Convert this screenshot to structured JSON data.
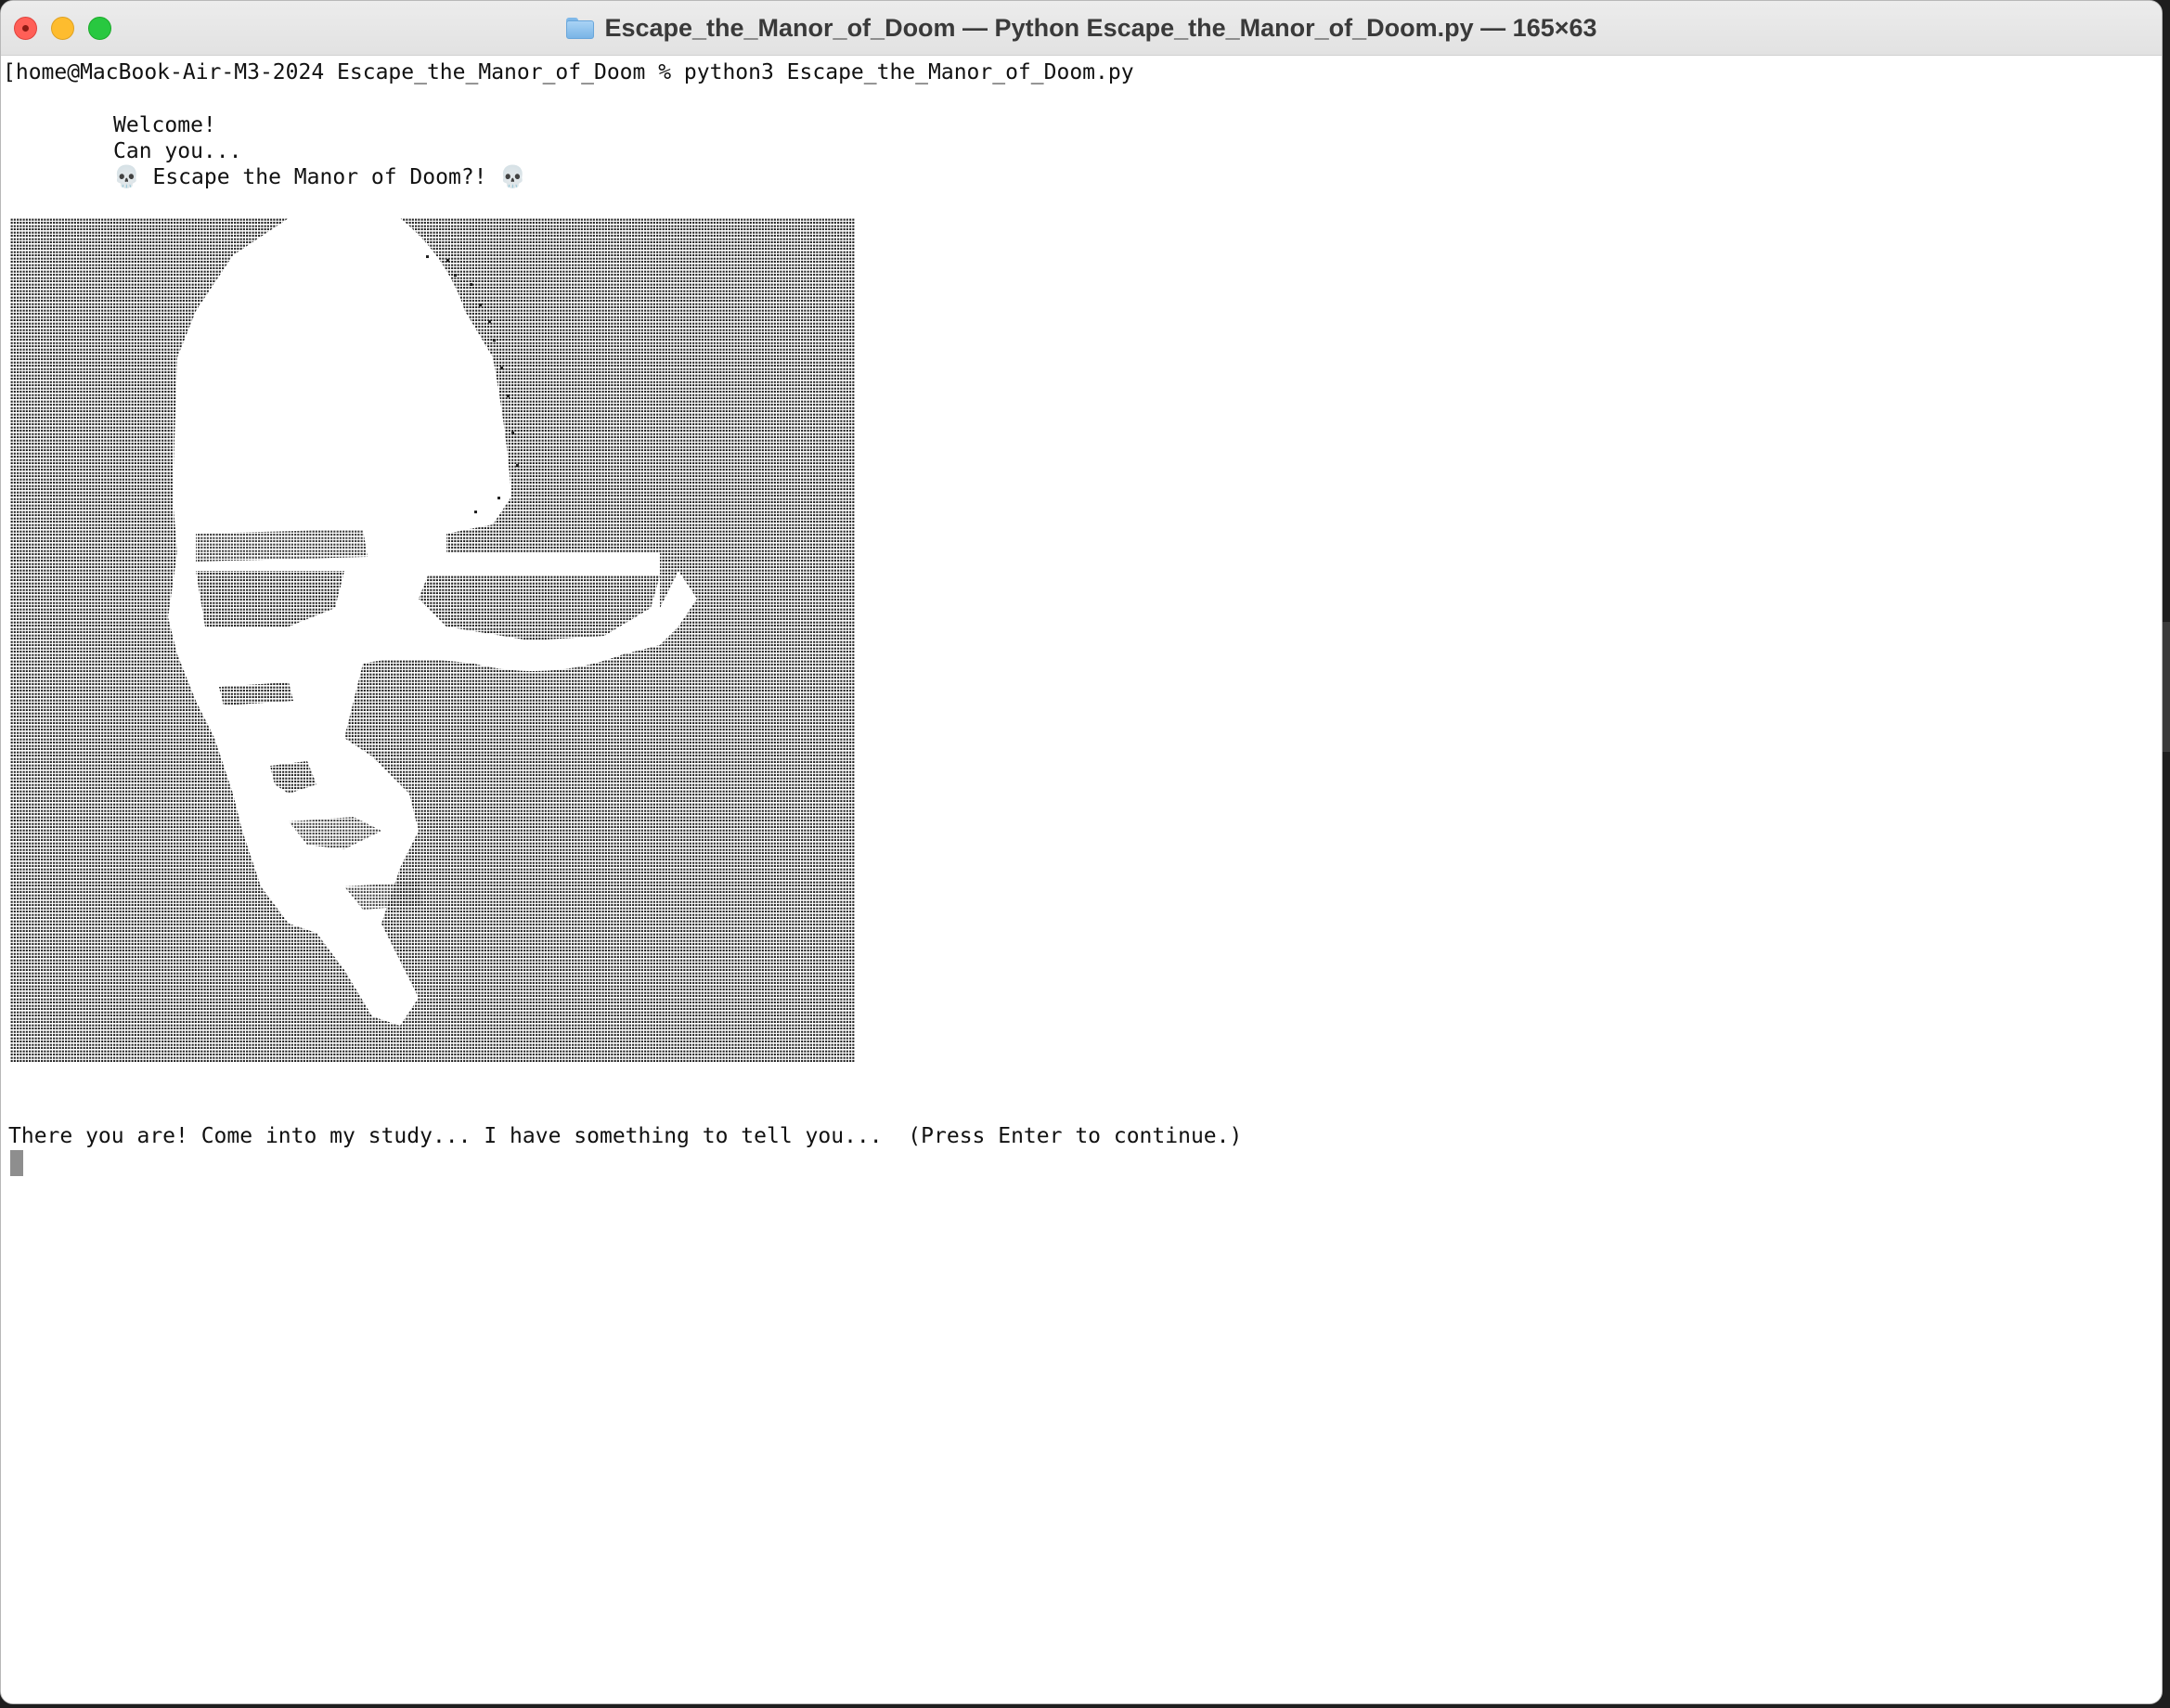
{
  "window": {
    "title": "Escape_the_Manor_of_Doom — Python Escape_the_Manor_of_Doom.py — 165×63"
  },
  "terminal": {
    "prompt_line": "[home@MacBook-Air-M3-2024 Escape_the_Manor_of_Doom % python3 Escape_the_Manor_of_Doom.py",
    "welcome": "Welcome!",
    "can_you": "Can you...",
    "game_title": "💀 Escape the Manor of Doom?! 💀",
    "ascii_art_icon": "skull-portrait-braille-art",
    "message": "There you are! Come into my study... I have something to tell you...  (Press Enter to continue.)"
  },
  "colors": {
    "text": "#111111",
    "background": "#ffffff",
    "close": "#ff5f57",
    "minimize": "#febc2e",
    "zoom": "#28c840",
    "cursor": "#8e8e8e"
  }
}
